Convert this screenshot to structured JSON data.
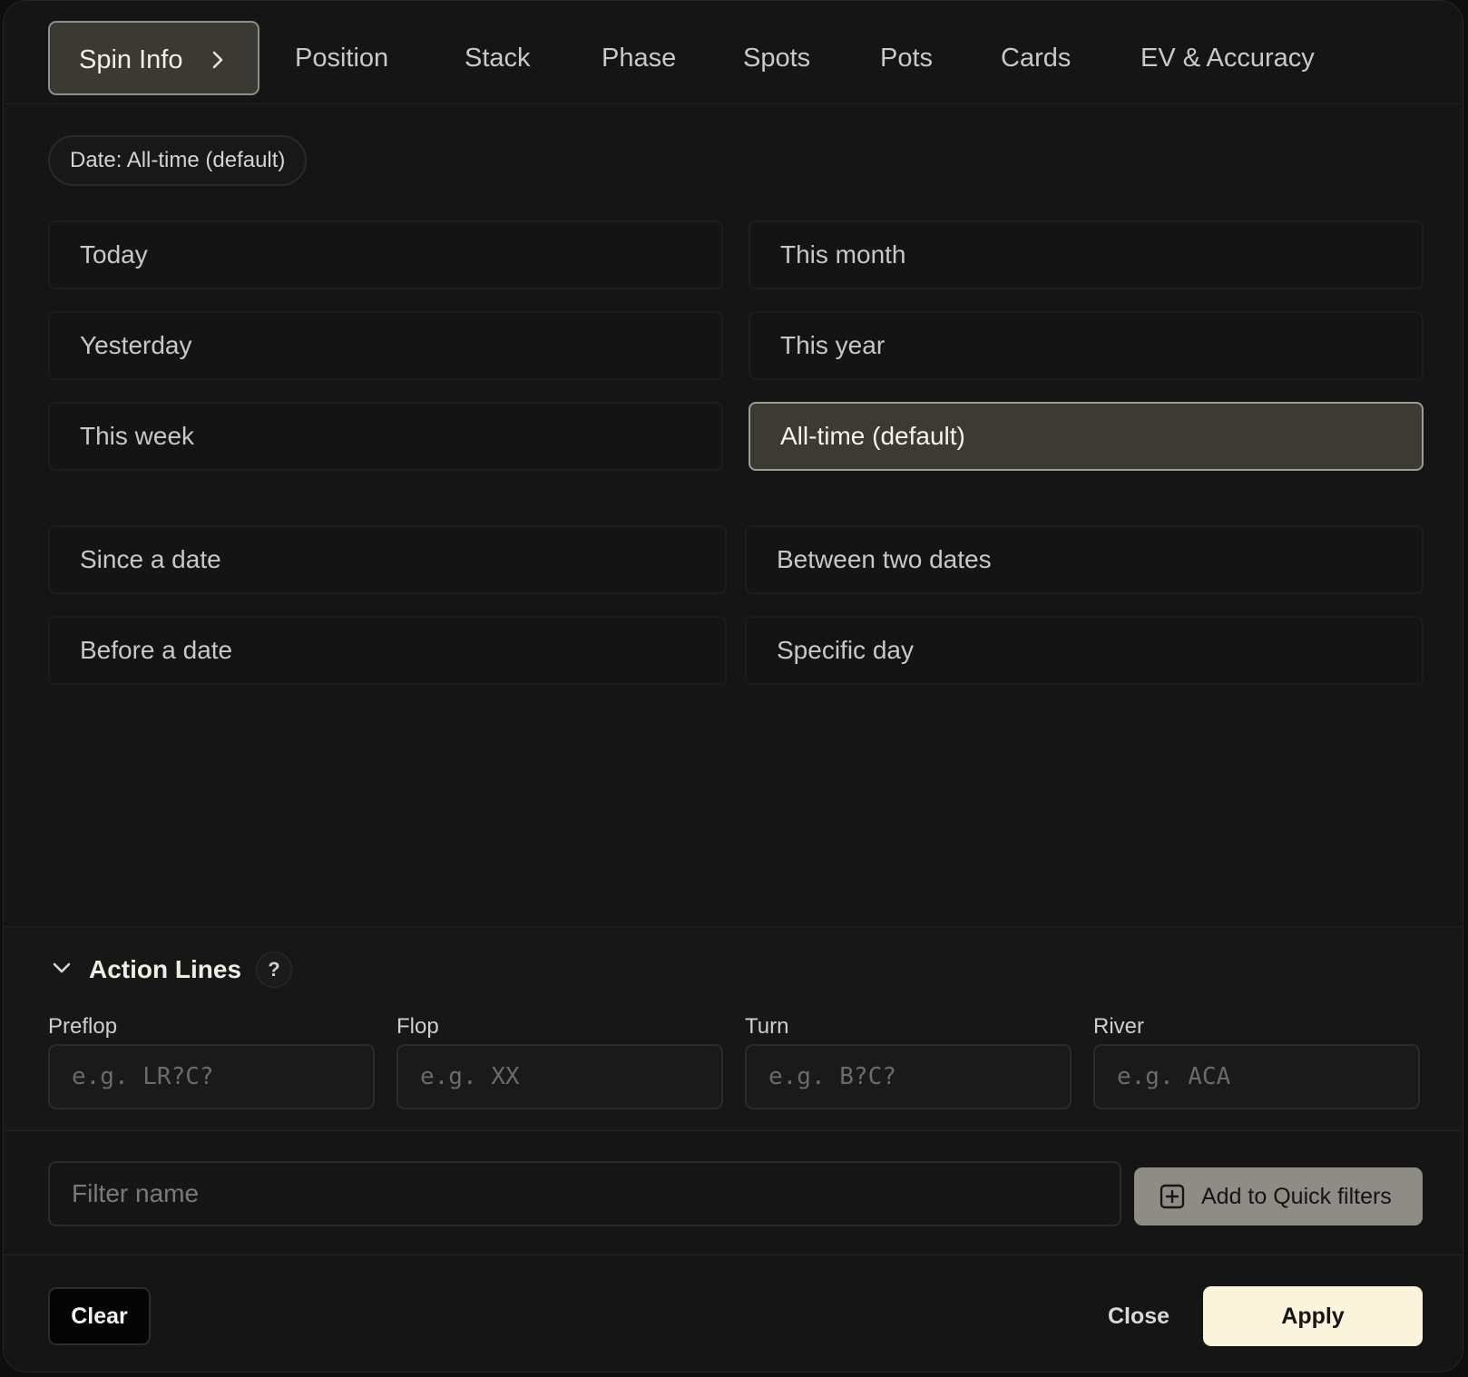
{
  "tabs": [
    {
      "label": "Spin Info",
      "active": true
    },
    {
      "label": "Position"
    },
    {
      "label": "Stack"
    },
    {
      "label": "Phase"
    },
    {
      "label": "Spots"
    },
    {
      "label": "Pots"
    },
    {
      "label": "Cards"
    },
    {
      "label": "EV & Accuracy"
    }
  ],
  "date_chip": "Date: All-time (default)",
  "date_options": {
    "today": "Today",
    "yesterday": "Yesterday",
    "this_week": "This week",
    "this_month": "This month",
    "this_year": "This year",
    "all_time": "All-time (default)",
    "selected": "all_time"
  },
  "custom_options": {
    "since": "Since a date",
    "before": "Before a date",
    "between": "Between two dates",
    "specific": "Specific day"
  },
  "action_lines": {
    "title": "Action Lines",
    "help": "?",
    "fields": [
      {
        "label": "Preflop",
        "placeholder": "e.g. LR?C?"
      },
      {
        "label": "Flop",
        "placeholder": "e.g. XX"
      },
      {
        "label": "Turn",
        "placeholder": "e.g. B?C?"
      },
      {
        "label": "River",
        "placeholder": "e.g. ACA"
      }
    ]
  },
  "filter_name": {
    "placeholder": "Filter name"
  },
  "quick_filters_label": "Add to Quick filters",
  "footer": {
    "clear": "Clear",
    "close": "Close",
    "apply": "Apply"
  },
  "colors": {
    "accent": "#fbf4dc",
    "selected_bg": "#3b3a35",
    "panel_bg": "#151515"
  },
  "icons": {
    "tab_chevron": "chevron-right-icon",
    "collapse": "chevron-down-icon",
    "quick_add": "plus-square-icon"
  }
}
